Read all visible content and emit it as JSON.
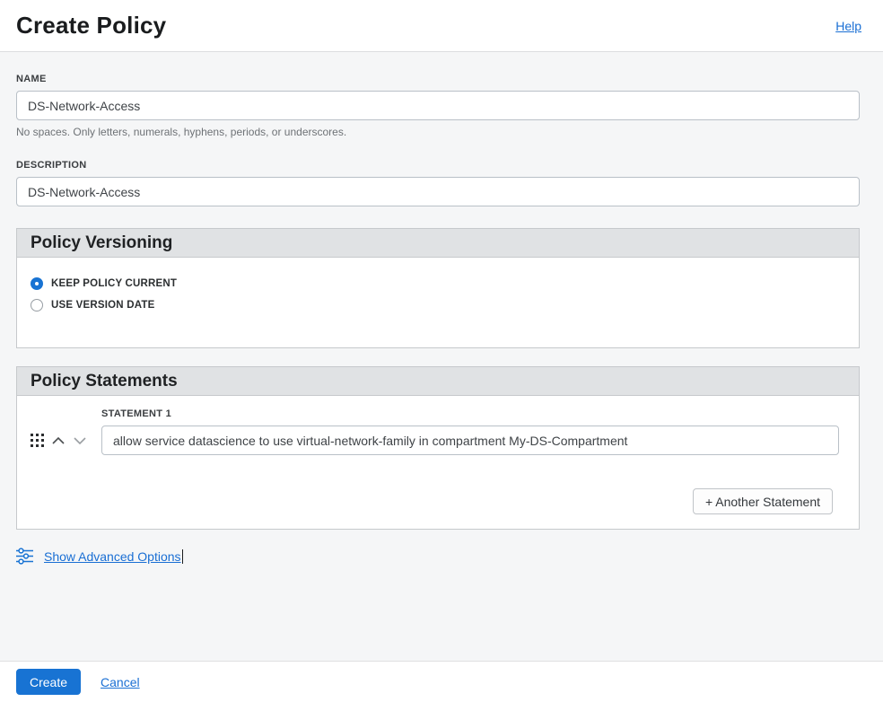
{
  "colors": {
    "accent_blue": "#1873d3",
    "link_blue": "#1a6fd4",
    "section_header_bg": "#e0e2e4",
    "page_bg": "#f5f6f7"
  },
  "header": {
    "title": "Create Policy",
    "help_label": "Help"
  },
  "form": {
    "name": {
      "label": "NAME",
      "value": "DS-Network-Access",
      "helper": "No spaces. Only letters, numerals, hyphens, periods, or underscores."
    },
    "description": {
      "label": "DESCRIPTION",
      "value": "DS-Network-Access"
    }
  },
  "versioning": {
    "title": "Policy Versioning",
    "options": [
      {
        "label": "KEEP POLICY CURRENT",
        "selected": true
      },
      {
        "label": "USE VERSION DATE",
        "selected": false
      }
    ]
  },
  "statements": {
    "title": "Policy Statements",
    "items": [
      {
        "label": "STATEMENT 1",
        "value": "allow service datascience to use virtual-network-family in compartment My-DS-Compartment"
      }
    ],
    "add_button_label": "+ Another Statement"
  },
  "advanced": {
    "link_label": "Show Advanced Options"
  },
  "footer": {
    "create_label": "Create",
    "cancel_label": "Cancel"
  }
}
